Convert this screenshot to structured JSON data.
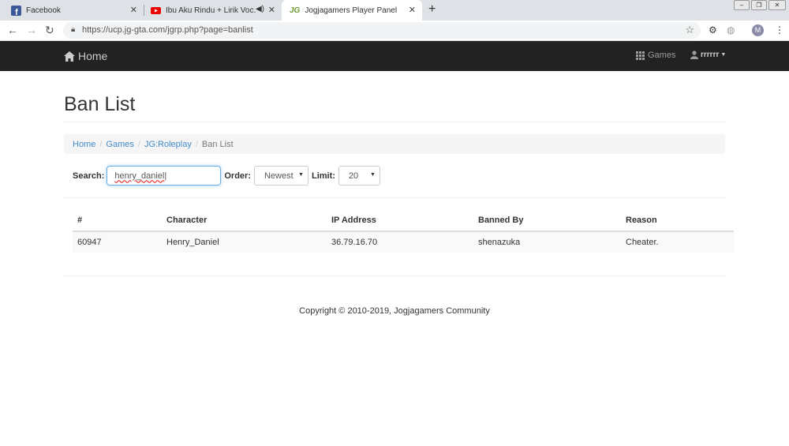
{
  "browser": {
    "tabs": [
      {
        "title": "Facebook",
        "close": "✕"
      },
      {
        "title": "Ibu Aku Rindu + Lirik Voc. Gi",
        "close": "✕"
      },
      {
        "title": "Jogjagamers Player Panel",
        "close": "✕"
      }
    ],
    "new_tab": "+",
    "url": "https://ucp.jg-gta.com/jgrp.php?page=banlist",
    "profile_initial": "M"
  },
  "navbar": {
    "brand": "Home",
    "games": "Games",
    "user": "rrrrrr"
  },
  "page": {
    "title": "Ban List",
    "breadcrumb": [
      "Home",
      "Games",
      "JG:Roleplay",
      "Ban List"
    ]
  },
  "filters": {
    "search_label": "Search:",
    "search_value": "henry_daniel",
    "order_label": "Order:",
    "order_value": "Newest",
    "limit_label": "Limit:",
    "limit_value": "20"
  },
  "table": {
    "headers": [
      "#",
      "Character",
      "IP Address",
      "Banned By",
      "Reason"
    ],
    "rows": [
      [
        "60947",
        "Henry_Daniel",
        "36.79.16.70",
        "shenazuka",
        "Cheater."
      ]
    ]
  },
  "footer": "Copyright © 2010-2019, Jogjagamers Community",
  "colors": {
    "navbar": "#222222",
    "link": "#428bca",
    "focus": "#66afe9"
  }
}
